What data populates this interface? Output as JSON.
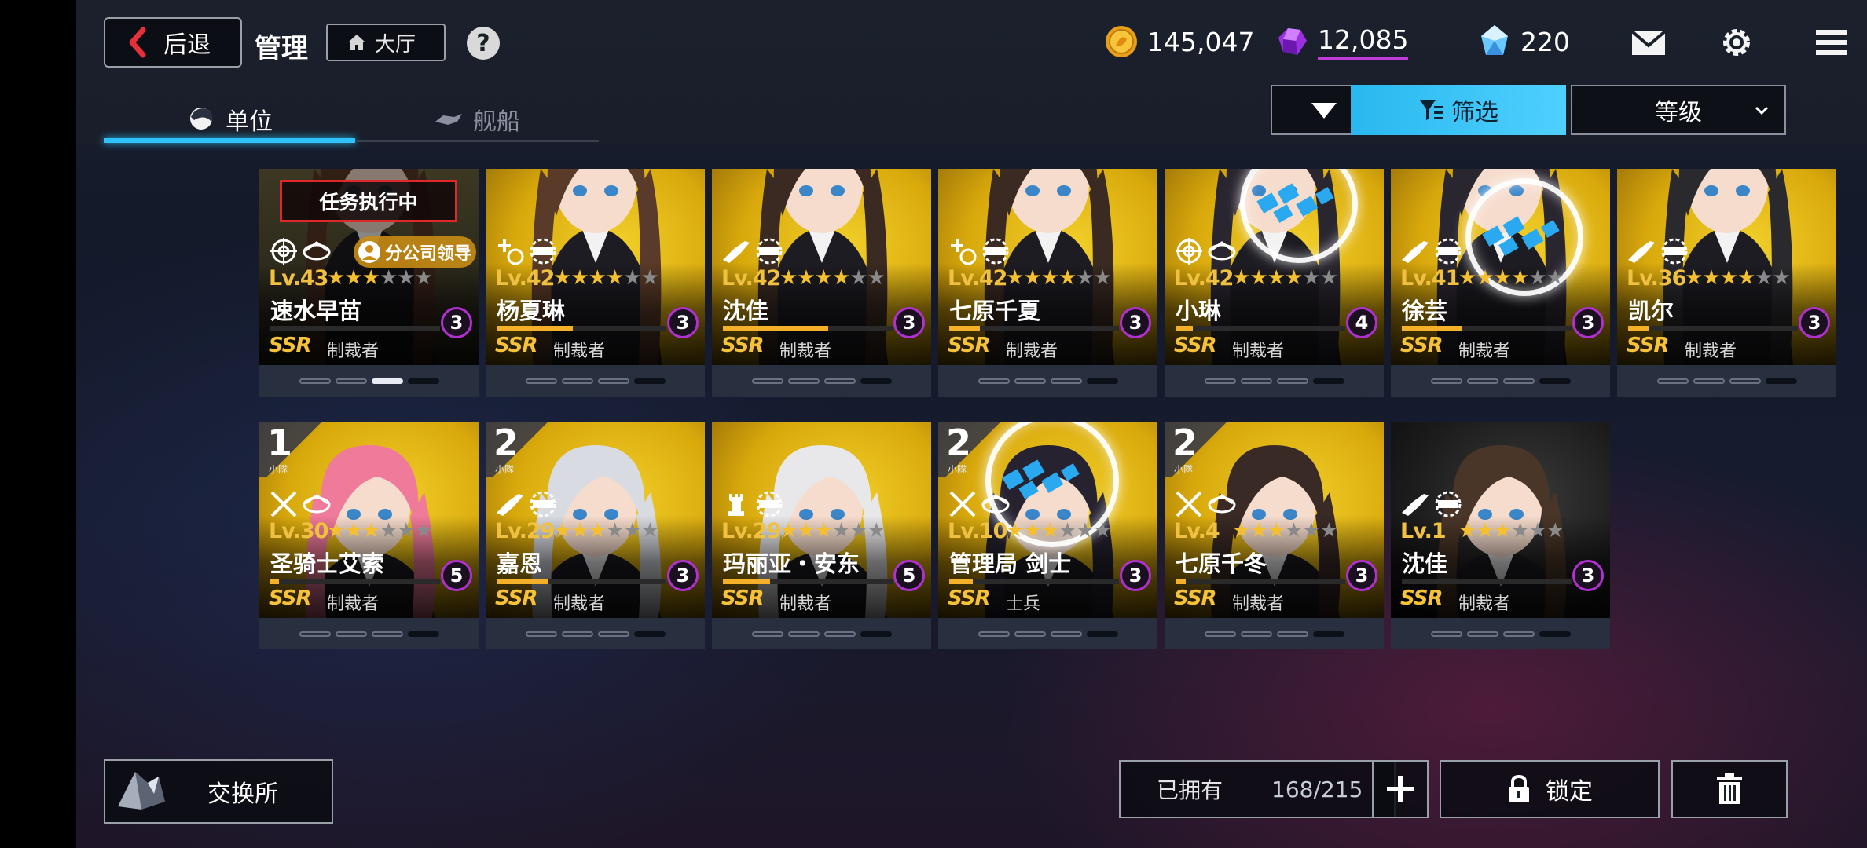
{
  "header": {
    "back_label": "后退",
    "title": "管理",
    "lobby_label": "大厅",
    "help_label": "?"
  },
  "currencies": {
    "gold": "145,047",
    "gems": "12,085",
    "crystals": "220"
  },
  "tabs": {
    "units": "单位",
    "ships": "舰船"
  },
  "toolbar": {
    "filter_label": "筛选",
    "sort_label": "等级"
  },
  "units": [
    {
      "name": "速水早苗",
      "level": "Lv.43",
      "stars": 3,
      "badge": "3",
      "rarity": "SSR",
      "class": "制裁者",
      "mission": "任务执行中",
      "branch": "分公司领导",
      "progress": 0.0,
      "bar_active": 2
    },
    {
      "name": "杨夏琳",
      "level": "Lv.42",
      "stars": 4,
      "badge": "3",
      "rarity": "SSR",
      "class": "制裁者",
      "progress": 0.45,
      "bar_active": -1
    },
    {
      "name": "沈佳",
      "level": "Lv.42",
      "stars": 4,
      "badge": "3",
      "rarity": "SSR",
      "class": "制裁者",
      "progress": 0.62,
      "bar_active": -1
    },
    {
      "name": "七原千夏",
      "level": "Lv.42",
      "stars": 4,
      "badge": "3",
      "rarity": "SSR",
      "class": "制裁者",
      "progress": 0.18,
      "bar_active": -1
    },
    {
      "name": "小琳",
      "level": "Lv.42",
      "stars": 4,
      "badge": "4",
      "rarity": "SSR",
      "class": "制裁者",
      "progress": 0.1,
      "bar_active": -1
    },
    {
      "name": "徐芸",
      "level": "Lv.41",
      "stars": 4,
      "badge": "3",
      "rarity": "SSR",
      "class": "制裁者",
      "progress": 0.35,
      "bar_active": -1
    },
    {
      "name": "凯尔",
      "level": "Lv.36",
      "stars": 4,
      "badge": "3",
      "rarity": "SSR",
      "class": "制裁者",
      "progress": 0.12,
      "bar_active": -1
    },
    {
      "name": "圣骑士艾索",
      "level": "Lv.30",
      "stars": 3,
      "badge": "5",
      "rarity": "SSR",
      "class": "制裁者",
      "squad": "1",
      "squad_sub": "小隊",
      "progress": 0.05,
      "bar_active": -1
    },
    {
      "name": "嘉恩",
      "level": "Lv.29",
      "stars": 3,
      "badge": "3",
      "rarity": "SSR",
      "class": "制裁者",
      "squad": "2",
      "squad_sub": "小隊",
      "progress": 0.3,
      "bar_active": -1
    },
    {
      "name": "玛丽亚・安东",
      "level": "Lv.29",
      "stars": 3,
      "badge": "5",
      "rarity": "SSR",
      "class": "制裁者",
      "progress": 0.28,
      "bar_active": -1
    },
    {
      "name": "管理局 剑士",
      "level": "Lv.10",
      "stars": 3,
      "badge": "3",
      "rarity": "SSR",
      "class": "士兵",
      "squad": "2",
      "squad_sub": "小隊",
      "progress": 0.14,
      "bar_active": -1
    },
    {
      "name": "七原千冬",
      "level": "Lv.4",
      "stars": 3,
      "badge": "3",
      "rarity": "SSR",
      "class": "制裁者",
      "squad": "2",
      "squad_sub": "小隊",
      "progress": 0.06,
      "bar_active": -1
    },
    {
      "name": "沈佳",
      "level": "Lv.1",
      "stars": 3,
      "badge": "3",
      "rarity": "SSR",
      "class": "制裁者",
      "progress": 0.0,
      "bar_active": -1
    }
  ],
  "footer": {
    "exchange_label": "交换所",
    "owned_label": "已拥有",
    "owned_count": "168/215",
    "lock_label": "锁定"
  },
  "colors": {
    "accent": "#2ec2ff",
    "badge_ring": "#b030d0",
    "rarity": "#f6c23a",
    "mission_border": "#e02828"
  }
}
